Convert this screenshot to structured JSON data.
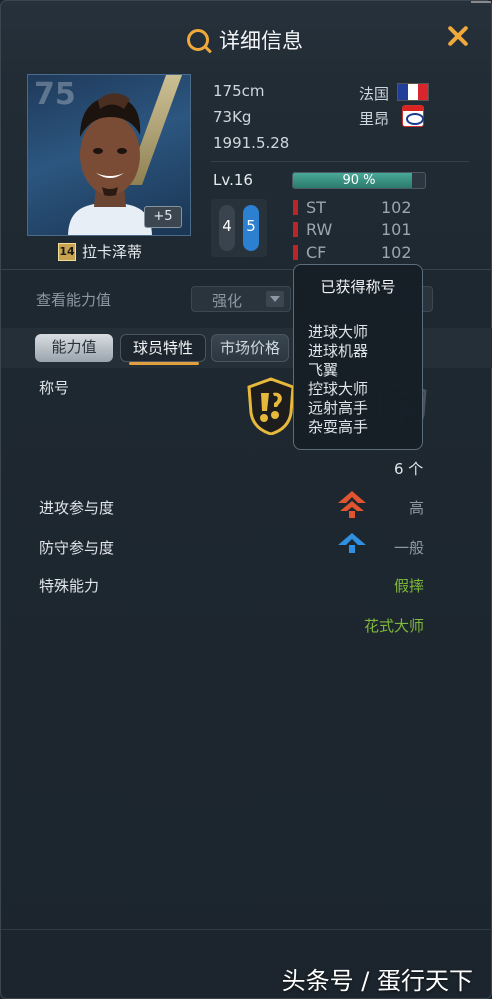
{
  "header": {
    "title": "详细信息"
  },
  "card": {
    "ovr": "75",
    "plus": "+5",
    "number": "14",
    "name": "拉卡泽蒂"
  },
  "info": {
    "height": "175cm",
    "weight": "73Kg",
    "birth": "1991.5.28",
    "nation": "法国",
    "club": "里昂",
    "level": "Lv.16",
    "exp_percent": 90,
    "exp_text": "90 %",
    "weak_foot_left": "4",
    "weak_foot_right": "5"
  },
  "positions": [
    {
      "name": "ST",
      "value": "102"
    },
    {
      "name": "RW",
      "value": "101"
    },
    {
      "name": "CF",
      "value": "102"
    }
  ],
  "ability": {
    "label": "查看能力值",
    "enhance_label": "强化"
  },
  "tabs": [
    {
      "label": "能力值"
    },
    {
      "label": "球员特性"
    },
    {
      "label": "市场价格"
    }
  ],
  "traits": {
    "titles_label": "称号",
    "titles_count": "6 个",
    "attack_label": "进攻参与度",
    "attack_value": "高",
    "defense_label": "防守参与度",
    "defense_value": "一般",
    "special_label": "特殊能力",
    "special_values": [
      "假摔",
      "花式大师"
    ]
  },
  "tooltip": {
    "title": "已获得称号",
    "items": [
      "进球大师",
      "进球机器",
      "飞翼",
      "控球大师",
      "远射高手",
      "杂耍高手"
    ]
  },
  "colors": {
    "accent": "#f0a93b",
    "special_green": "#7fb93c",
    "attack_arrow": "#e0542f",
    "defense_arrow": "#2f8fe0",
    "position_mark": "#b8262a"
  },
  "watermark": "头条号 / 蛋行天下"
}
